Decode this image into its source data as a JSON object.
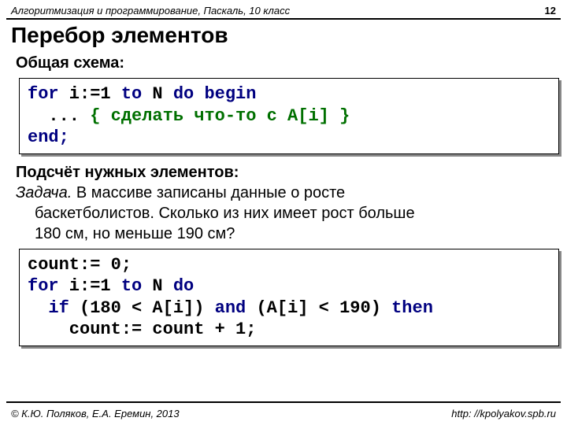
{
  "header": {
    "course": "Алгоритмизация и программирование, Паскаль, 10 класс",
    "pageNumber": "12"
  },
  "title": "Перебор элементов",
  "section1": {
    "label": "Общая схема:",
    "code": {
      "line1a": "for",
      "line1b": " i:=",
      "line1c": "1",
      "line1d": " to",
      "line1e": " N ",
      "line1f": "do begin",
      "line2a": "  ... ",
      "line2b": "{ сделать что-то с A[i] }",
      "line3": "end;"
    }
  },
  "section2": {
    "label": "Подсчёт нужных элементов:",
    "taskWord": "Задача.",
    "taskText1": " В массиве записаны данные о росте",
    "taskText2": "баскетболистов. Сколько из них имеет рост больше",
    "taskText3": "180 см, но меньше 190 см?",
    "code": {
      "l1a": "count:= ",
      "l1b": "0",
      "l1c": ";",
      "l2a": "for",
      "l2b": " i:=",
      "l2c": "1",
      "l2d": " to",
      "l2e": " N ",
      "l2f": "do",
      "l3a": "  if",
      "l3b": " (",
      "l3c": "180",
      "l3d": " < A[i]) ",
      "l3e": "and",
      "l3f": " (A[i] < ",
      "l3g": "190",
      "l3h": ") ",
      "l3i": "then",
      "l4a": "    count:= count + ",
      "l4b": "1",
      "l4c": ";"
    }
  },
  "footer": {
    "copyright": "© К.Ю. Поляков, Е.А. Еремин, 2013",
    "url": "http: //kpolyakov.spb.ru"
  }
}
